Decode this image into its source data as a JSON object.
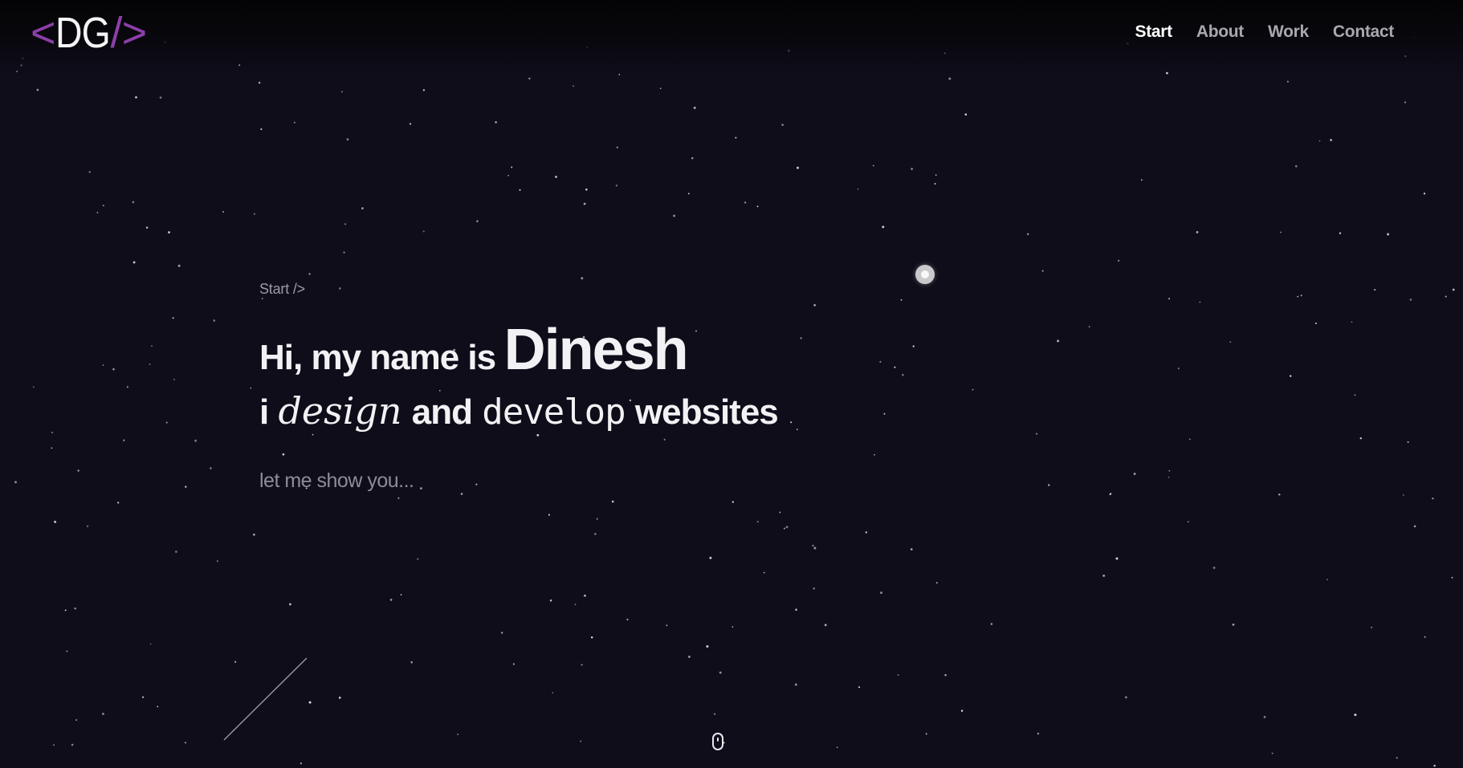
{
  "logo": {
    "open": "<",
    "letters": "DG",
    "slash": "/",
    "close": ">"
  },
  "nav": {
    "items": [
      {
        "label": "Start",
        "active": true
      },
      {
        "label": "About",
        "active": false
      },
      {
        "label": "Work",
        "active": false
      },
      {
        "label": "Contact",
        "active": false
      }
    ]
  },
  "hero": {
    "breadcrumb": "Start />",
    "greeting": "Hi, my name is",
    "name": "Dinesh",
    "line2": {
      "i": "i",
      "design": "design",
      "and": "and",
      "develop": "develop",
      "websites": "websites"
    },
    "tagline": "let me show you..."
  },
  "colors": {
    "background": "#0f0d1a",
    "accent": "#8b3fa8",
    "nav_inactive": "#a9a7b0",
    "text": "#f2f2f4"
  },
  "icons": {
    "moon": "moon-icon",
    "scroll": "mouse-scroll-icon"
  }
}
